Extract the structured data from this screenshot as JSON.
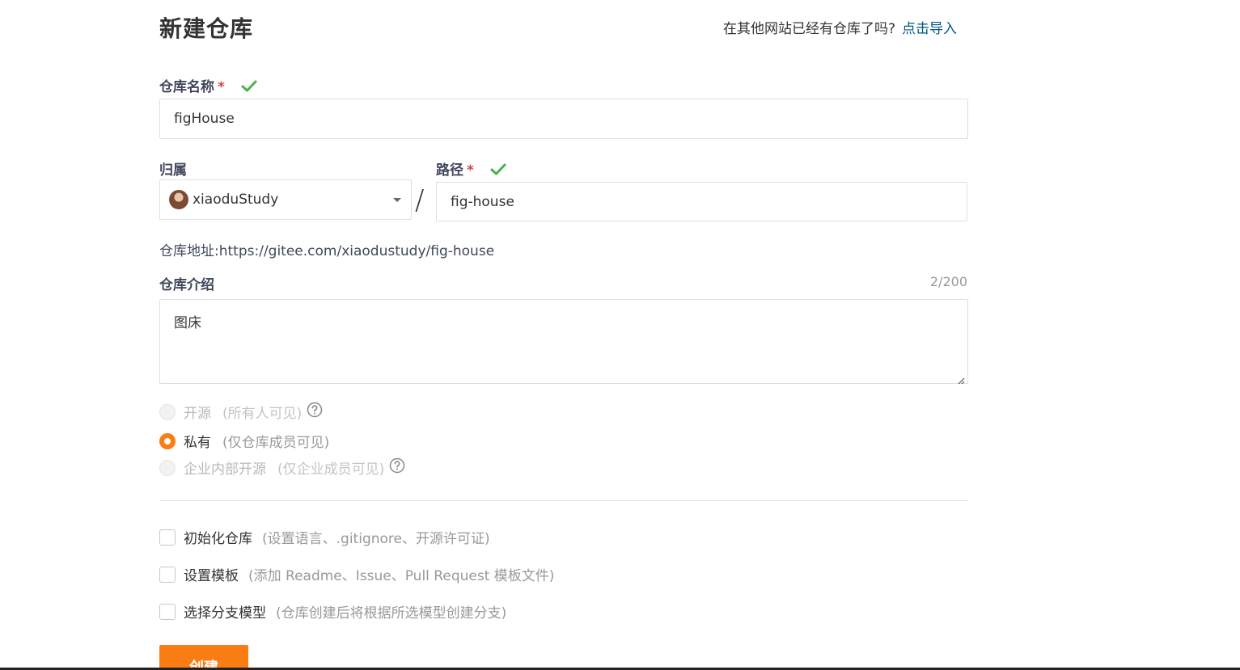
{
  "page": {
    "title": "新建仓库",
    "import_question": "在其他网站已经有仓库了吗?",
    "import_link": "点击导入"
  },
  "form": {
    "repo_name": {
      "label": "仓库名称",
      "required_mark": "*",
      "value": "figHouse"
    },
    "owner": {
      "label": "归属",
      "value": "xiaoduStudy"
    },
    "separator": "/",
    "path": {
      "label": "路径",
      "required_mark": "*",
      "value": "fig-house"
    },
    "repo_url": {
      "label": "仓库地址:",
      "value": "https://gitee.com/xiaodustudy/fig-house"
    },
    "description": {
      "label": "仓库介绍",
      "counter": "2/200",
      "value": "图床"
    },
    "visibility": [
      {
        "label": "开源",
        "hint": "(所有人可见)",
        "state": "disabled"
      },
      {
        "label": "私有",
        "hint": "(仅仓库成员可见)",
        "state": "checked"
      },
      {
        "label": "企业内部开源",
        "hint": "(仅企业成员可见)",
        "state": "disabled"
      }
    ],
    "options": [
      {
        "label": "初始化仓库",
        "hint": "(设置语言、.gitignore、开源许可证)",
        "checked": false
      },
      {
        "label": "设置模板",
        "hint": "(添加 Readme、Issue、Pull Request 模板文件)",
        "checked": false
      },
      {
        "label": "选择分支模型",
        "hint": "(仓库创建后将根据所选模型创建分支)",
        "checked": false
      }
    ],
    "submit_label": "创建"
  },
  "colors": {
    "accent": "#fa7d14",
    "link": "#005980",
    "valid": "#4caf50",
    "required": "#d64545"
  }
}
